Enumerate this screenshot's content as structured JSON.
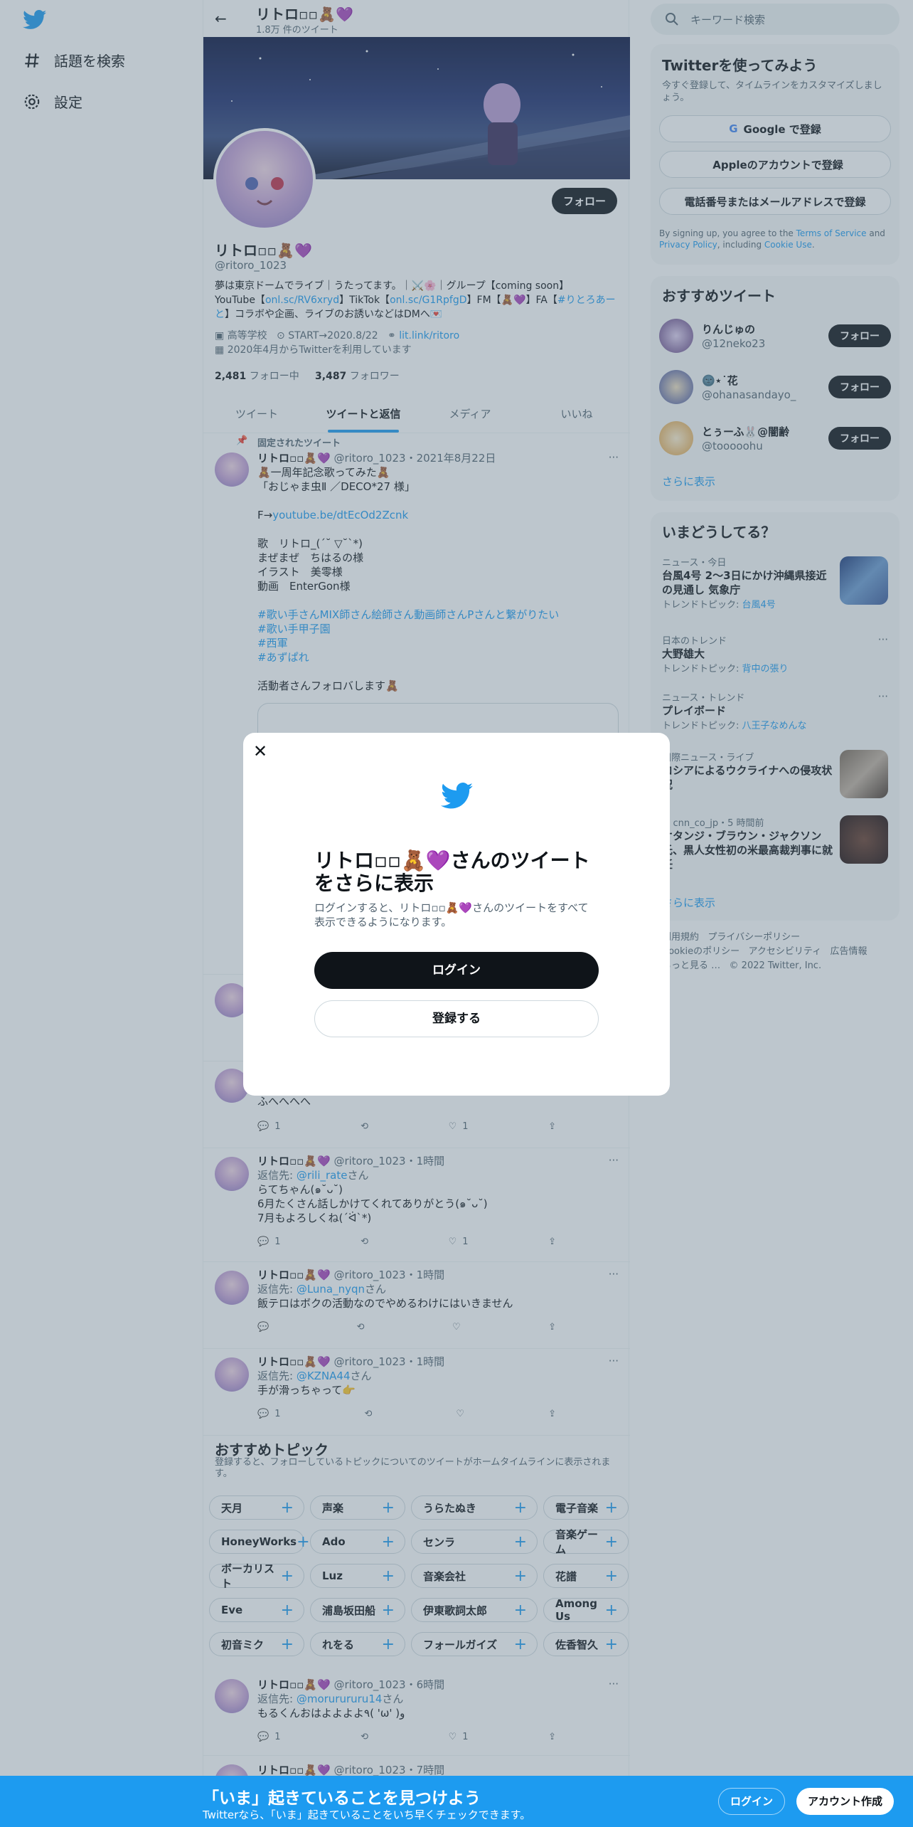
{
  "nav": {
    "explore": "話題を検索",
    "settings": "設定"
  },
  "header": {
    "name": "リトロ▫▫🧸💜",
    "tweet_count": "1.8万 件のツイート"
  },
  "profile": {
    "follow": "フォロー",
    "name": "リトロ▫▫🧸💜",
    "handle": "@ritoro_1023",
    "bio_line1": "夢は東京ドームでライブ｜うたってます。｜⚔️🌸｜グループ【coming soon】",
    "bio_line2a": "YouTube【",
    "bio_link1": "onl.sc/RV6xryd",
    "bio_line2b": "】TikTok【",
    "bio_link2": "onl.sc/G1RpfgD",
    "bio_line2c": "】FM【🧸💜】FA【",
    "bio_link3": "#りとろあーと",
    "bio_line2d": "】コラボや企画、ライブのお誘いなどはDMへ💌",
    "meta_school": "高等学校",
    "meta_location": "START→2020.8/22",
    "meta_link": "lit.link/ritoro",
    "meta_joined": "2020年4月からTwitterを利用しています",
    "following_count": "2,481",
    "following_label": "フォロー中",
    "followers_count": "3,487",
    "followers_label": "フォロワー"
  },
  "tabs": [
    "ツイート",
    "ツイートと返信",
    "メディア",
    "いいね"
  ],
  "pinned": {
    "label": "固定されたツイート",
    "name": "リトロ▫▫🧸💜",
    "handle": "@ritoro_1023",
    "date": "・2021年8月22日",
    "lines": [
      "🧸一周年記念歌ってみた🧸",
      "「おじゃま虫Ⅱ ／DECO*27 様」",
      "",
      "F→",
      "",
      "歌　リトロ_(ˊ˘ ▽˘ˋ*)",
      "まぜまぜ　ちはるの様",
      "イラスト　美零様",
      "動画　EnterGon様",
      "",
      "#歌い手さんMIX師さん絵師さん動画師さんPさんと繋がりたい",
      "#歌い手甲子園",
      "#西軍",
      "#あずぱれ",
      "",
      "活動者さんフォロバします🧸"
    ],
    "link": "youtube.be/dtEcOd2Zcnk"
  },
  "tweets": [
    {
      "name": "リトロ▫▫🧸💜",
      "handle": "@ritoro_1023",
      "time": "・1時間",
      "text": "ふへへへへ",
      "reply": "",
      "replies": "1",
      "likes": "1"
    },
    {
      "name": "リトロ▫▫🧸💜",
      "handle": "@ritoro_1023",
      "time": "・1時間",
      "reply_prefix": "返信先: ",
      "reply": "@rili_rate",
      "reply_suffix": "さん",
      "text1": "らてちゃん(๑˘ᴗ˘)",
      "text2": "6月たくさん話しかけてくれてありがとう(๑˘ᴗ˘)",
      "text3": "7月もよろしくね(ˊᐛˋ*)",
      "replies": "1",
      "likes": "1"
    },
    {
      "name": "リトロ▫▫🧸💜",
      "handle": "@ritoro_1023",
      "time": "・1時間",
      "reply_prefix": "返信先: ",
      "reply": "@Luna_nyqn",
      "reply_suffix": "さん",
      "text1": "飯テロはボクの活動なのでやめるわけにはいきません",
      "replies": "",
      "likes": ""
    },
    {
      "name": "リトロ▫▫🧸💜",
      "handle": "@ritoro_1023",
      "time": "・1時間",
      "reply_prefix": "返信先: ",
      "reply": "@KZNA44",
      "reply_suffix": "さん",
      "text1": "手が滑っちゃって👉",
      "replies": "1",
      "likes": ""
    },
    {
      "name": "リトロ▫▫🧸💜",
      "handle": "@ritoro_1023",
      "time": "・6時間",
      "reply_prefix": "返信先: ",
      "reply": "@morurururu14",
      "reply_suffix": "さん",
      "text1": "もるくんおはよよよよ٩( 'ω' )و",
      "replies": "1",
      "likes": "1"
    },
    {
      "name": "リトロ▫▫🧸💜",
      "handle": "@ritoro_1023",
      "time": "・7時間"
    }
  ],
  "topics": {
    "title": "おすすめトピック",
    "desc": "登録すると、フォローしているトピックについてのツイートがホームタイムラインに表示されます。",
    "rows": [
      [
        "天月",
        "声楽",
        "うらたぬき",
        "電子音楽"
      ],
      [
        "HoneyWorks",
        "Ado",
        "センラ",
        "音楽ゲーム"
      ],
      [
        "ボーカリスト",
        "Luz",
        "音楽会社",
        "花譜"
      ],
      [
        "Eve",
        "浦島坂田船",
        "伊東歌詞太郎",
        "Among Us"
      ],
      [
        "初音ミク",
        "れをる",
        "フォールガイズ",
        "佐香智久"
      ]
    ]
  },
  "right": {
    "search_placeholder": "キーワード検索",
    "signup_title": "Twitterを使ってみよう",
    "signup_desc": "今すぐ登録して、タイムラインをカスタマイズしましょう。",
    "google": "Google で登録",
    "apple": "Appleのアカウントで登録",
    "phone": "電話番号またはメールアドレスで登録",
    "terms_a": "By signing up, you agree to the ",
    "terms_link1": "Terms of Service",
    "terms_b": " and ",
    "terms_link2": "Privacy Policy",
    "terms_c": ", including ",
    "terms_link3": "Cookie Use",
    "terms_d": ".",
    "rec_title": "おすすめツイート",
    "recs": [
      {
        "name": "りんじゅの",
        "handle": "@12neko23",
        "btn": "フォロー"
      },
      {
        "name": "🌚⋆˙花",
        "handle": "@ohanasandayo_",
        "btn": "フォロー"
      },
      {
        "name": "とぅーふ🐰@闇齢",
        "handle": "@tooooohu",
        "btn": "フォロー"
      }
    ],
    "more": "さらに表示",
    "trends_title": "いまどうしてる？",
    "trends": [
      {
        "cat": "ニュース・今日",
        "title": "台風4号 2〜3日にかけ沖縄県接近の見通し 気象庁",
        "sub": "トレンドトピック: ",
        "sublink": "台風4号"
      },
      {
        "cat": "日本のトレンド",
        "title": "大野雄大",
        "sub": "トレンドトピック: ",
        "sublink": "背中の張り"
      },
      {
        "cat": "ニュース・トレンド",
        "title": "プレイボード",
        "sub": "トレンドトピック: ",
        "sublink": "八王子なめんな"
      },
      {
        "cat": "国際ニュース・ライブ",
        "title": "ロシアによるウクライナへの侵攻状況"
      },
      {
        "cat": "cnn_co_jp",
        "time": "・5 時間前",
        "title": "ケタンジ・ブラウン・ジャクソン氏、黒人女性初の米最高裁判事に就任"
      }
    ],
    "more2": "さらに表示",
    "footer": [
      "利用規約",
      "プライバシーポリシー",
      "Cookieのポリシー",
      "アクセシビリティ",
      "広告情報",
      "もっと見る …",
      "© 2022 Twitter, Inc."
    ]
  },
  "modal": {
    "title": "リトロ▫▫🧸💜さんのツイートをさらに表示",
    "desc": "ログインすると、リトロ▫▫🧸💜さんのツイートをすべて表示できるようになります。",
    "login": "ログイン",
    "register": "登録する"
  },
  "bottombar": {
    "title": "「いま」起きていることを見つけよう",
    "sub": "Twitterなら、「いま」起きていることをいち早くチェックできます。",
    "login": "ログイン",
    "signup": "アカウント作成"
  },
  "colors": {
    "accent": "#1d9bf0",
    "dark": "#0f1419",
    "gray": "#536471"
  }
}
